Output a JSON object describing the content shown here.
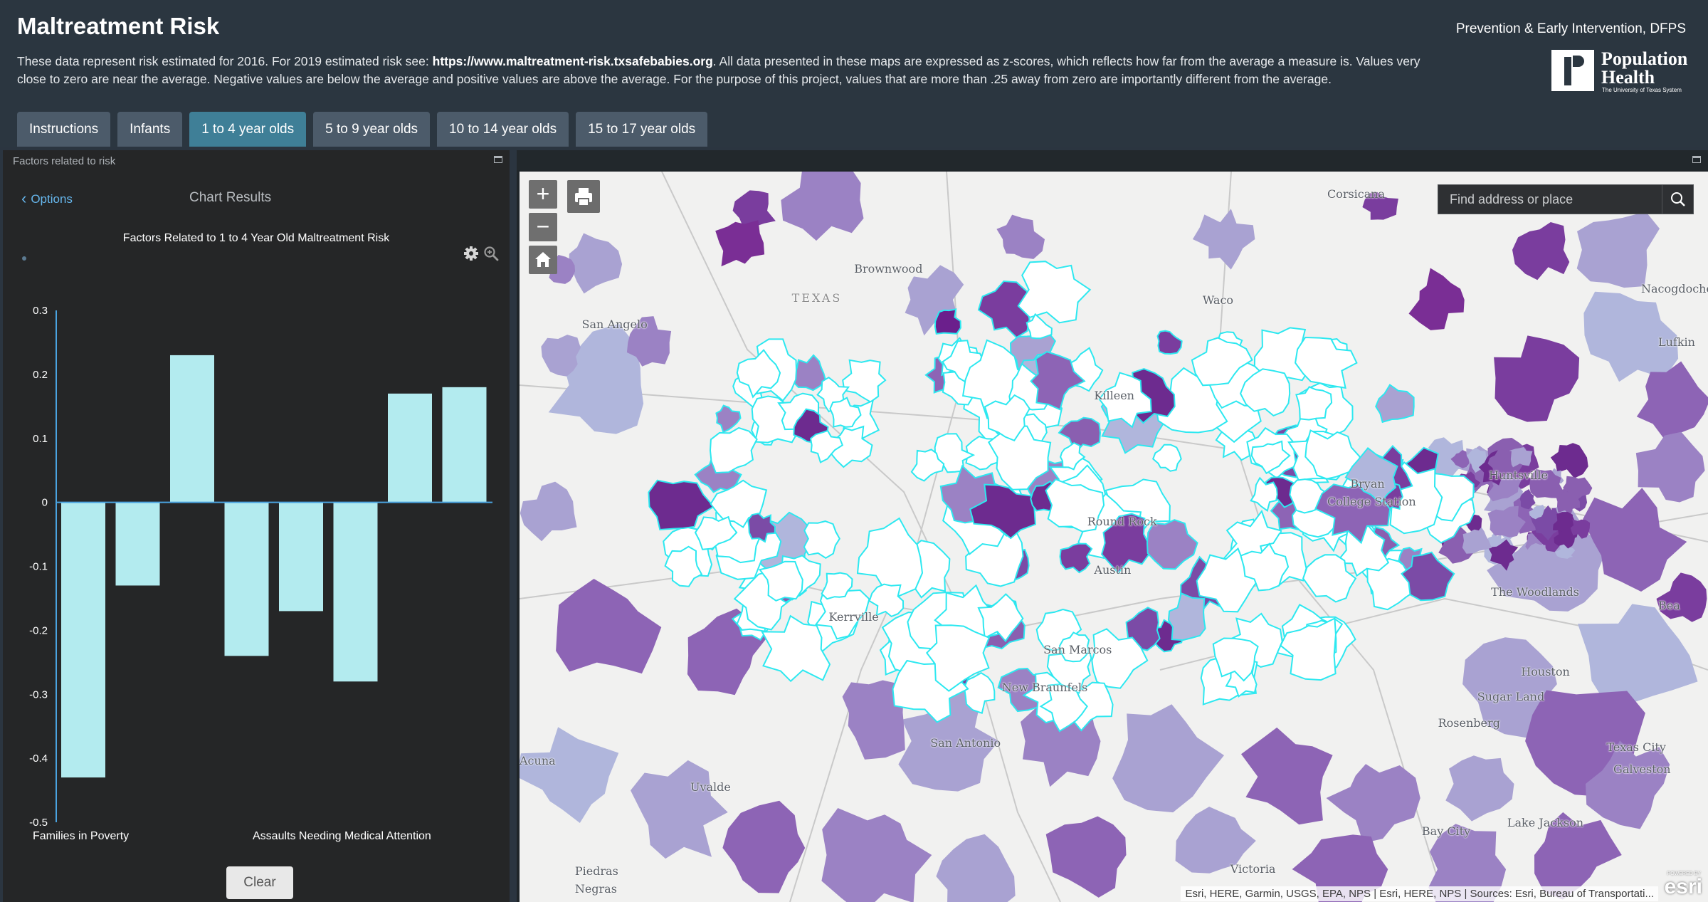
{
  "header": {
    "title": "Maltreatment Risk",
    "agency": "Prevention & Early Intervention, DFPS",
    "description_pre": "These data represent risk estimated for 2016. For 2019 estimated risk see: ",
    "description_url": "https://www.maltreatment-risk.txsafebabies.org",
    "description_post": ". All data presented in these maps are expressed as z-scores, which reflects how far from the average a measure is. Values very close to zero are near the average. Negative values are below the average and positive values are above the average. For the purpose of this project, values that are more than .25 away from zero are importantly different from the average.",
    "logo": {
      "line1": "Population",
      "line2": "Health",
      "line3": "The University of Texas System"
    }
  },
  "tabs": [
    {
      "label": "Instructions",
      "active": false
    },
    {
      "label": "Infants",
      "active": false
    },
    {
      "label": "1 to 4 year olds",
      "active": true
    },
    {
      "label": "5 to 9 year olds",
      "active": false
    },
    {
      "label": "10 to 14 year olds",
      "active": false
    },
    {
      "label": "15 to 17 year olds",
      "active": false
    }
  ],
  "left_panel": {
    "title": "Factors related to risk",
    "options_label": "Options",
    "results_label": "Chart Results",
    "clear_label": "Clear"
  },
  "chart_data": {
    "type": "bar",
    "title": "Factors Related to 1 to 4 Year Old Maltreatment Risk",
    "categories": [
      "Families in Poverty",
      "",
      "",
      "",
      "Assaults Needing Medical Attention",
      "",
      "",
      ""
    ],
    "values": [
      -0.43,
      -0.13,
      0.23,
      -0.24,
      -0.17,
      -0.28,
      0.17,
      0.18
    ],
    "ylim": [
      -0.5,
      0.3
    ],
    "yticks": [
      0.3,
      0.2,
      0.1,
      0,
      -0.1,
      -0.2,
      -0.3,
      -0.4,
      -0.5
    ],
    "ytick_labels": [
      "0.3",
      "0.2",
      "0.1",
      "0",
      "-0.1",
      "-0.2",
      "-0.3",
      "-0.4",
      "-0.5"
    ],
    "bar_color": "#b3ebef",
    "axis_color": "#4aa3e0",
    "grid": false
  },
  "map": {
    "search_placeholder": "Find address or place",
    "attribution": "Esri, HERE, Garmin, USGS, EPA, NPS | Esri, HERE, NPS | Sources: Esri, Bureau of Transportati...",
    "esri_powered": "POWERED BY",
    "esri_logo": "esri",
    "outline_color": "#2de8f0",
    "labels": [
      "Corsicana",
      "Brownwood",
      "TEXAS",
      "Waco",
      "Nacogdoches",
      "San Angelo",
      "Lufkin",
      "Killeen",
      "Huntsville",
      "Bryan",
      "College Station",
      "Round Rock",
      "Austin",
      "The Woodlands",
      "Kerrville",
      "San Marcos",
      "Houston",
      "Sugar Land",
      "New Braunfels",
      "Rosenberg",
      "San Antonio",
      "Texas City",
      "Galveston",
      "Uvalde",
      "Lake Jackson",
      "Bay City",
      "Victoria",
      "Piedras",
      "Negras",
      "Acuna",
      "Bea"
    ]
  }
}
